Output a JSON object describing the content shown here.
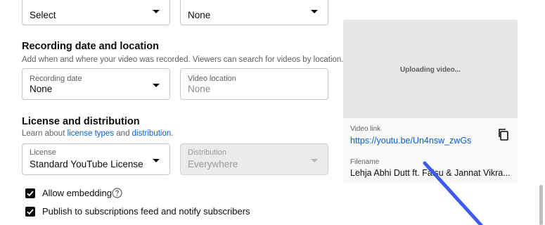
{
  "top_fields": [
    {
      "value": "Select"
    },
    {
      "value": "None"
    }
  ],
  "recording": {
    "title": "Recording date and location",
    "description": "Add when and where your video was recorded. Viewers can search for videos by location.",
    "date_label": "Recording date",
    "date_value": "None",
    "location_label": "Video location",
    "location_placeholder": "None"
  },
  "license": {
    "title": "License and distribution",
    "desc_prefix": "Learn about ",
    "link1": "license types",
    "desc_and": " and ",
    "link2": "distribution",
    "desc_suffix": ".",
    "license_label": "License",
    "license_value": "Standard YouTube License",
    "distribution_label": "Distribution",
    "distribution_value": "Everywhere"
  },
  "checkboxes": {
    "embedding": {
      "label": "Allow embedding",
      "checked": true
    },
    "publish": {
      "label": "Publish to subscriptions feed and notify subscribers",
      "checked": true
    }
  },
  "side_panel": {
    "status": "Uploading video...",
    "video_link_label": "Video link",
    "video_link": "https://youtu.be/Un4nsw_zwGs",
    "filename_label": "Filename",
    "filename": "Lehja Abhi Dutt ft. Faisu & Jannat Vikra..."
  },
  "icons": {
    "copy": "copy-icon",
    "help": "help-icon",
    "check": "checkmark-icon",
    "caret": "chevron-down-icon"
  },
  "colors": {
    "link": "#065fd4",
    "annotation_arrow": "#3d5bf0"
  }
}
